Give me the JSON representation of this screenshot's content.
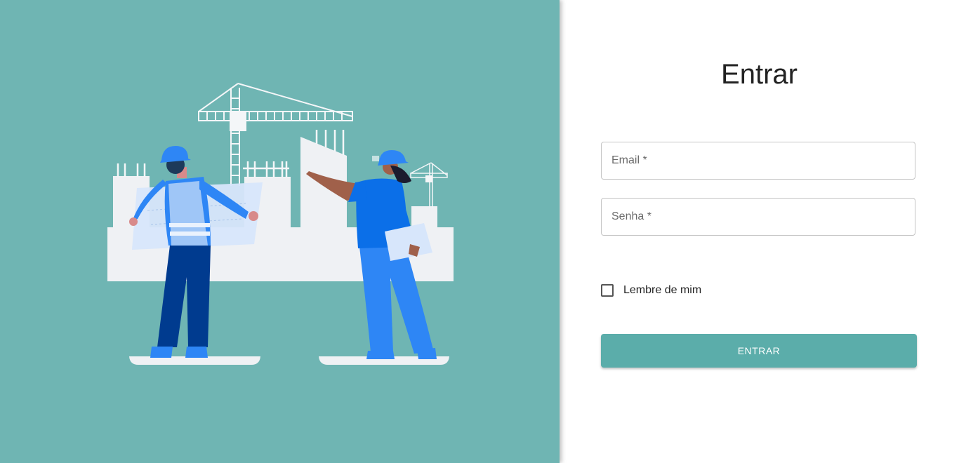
{
  "colors": {
    "left_background": "#6fb5b3",
    "accent_button": "#5badaa",
    "worker_blue": "#2e86f5",
    "worker_dark_blue": "#003b8f"
  },
  "illustration": {
    "description_icon": "construction-workers-illustration"
  },
  "login": {
    "title": "Entrar",
    "email_label": "Email *",
    "password_label": "Senha *",
    "remember_label": "Lembre de mim",
    "remember_checked": false,
    "submit_label": "ENTRAR"
  }
}
